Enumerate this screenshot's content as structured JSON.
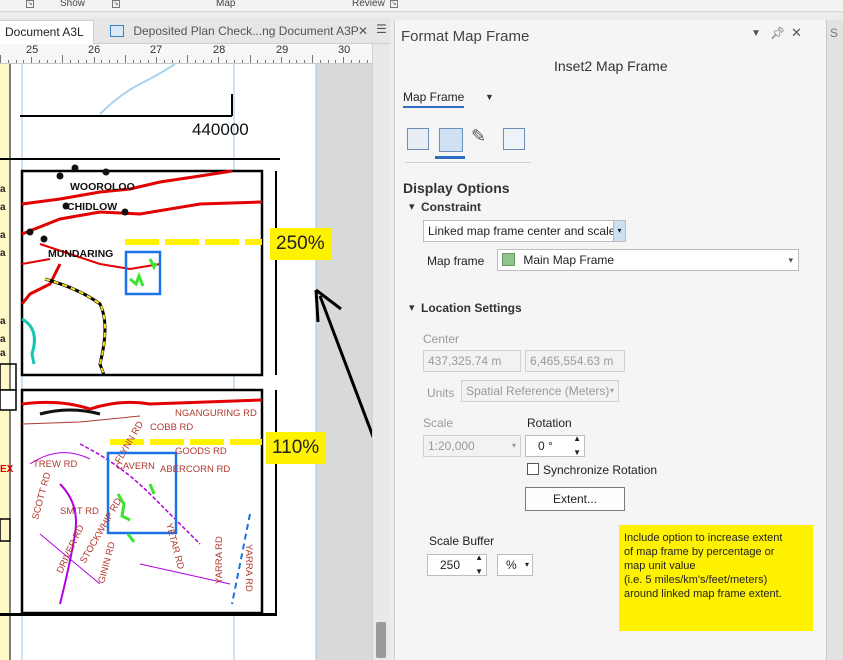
{
  "ribbon": {
    "groups": [
      "Show",
      "Map",
      "Review"
    ]
  },
  "tabs": [
    {
      "label": "Document A3L",
      "active": true
    },
    {
      "label": "Deposited Plan Check...ng Document A3P",
      "active": false
    }
  ],
  "ruler": {
    "marks": [
      "25",
      "26",
      "27",
      "28",
      "29",
      "30"
    ]
  },
  "map": {
    "coord_label": "440000",
    "top_frame_labels": [
      "WOOROLOO",
      "CHIDLOW",
      "MUNDARING"
    ],
    "bottom_frame_labels": [
      "FLYNN RD",
      "NGANGURING RD",
      "COBB RD",
      "GOODS RD",
      "CAVERN",
      "ABERCORN RD",
      "TREW RD",
      "SCOTT RD",
      "SMIT RD",
      "DRIVER RD",
      "STOCKWHIP RD",
      "GININ RD",
      "YETAR RD",
      "YARRA RD",
      "YARRA RD"
    ],
    "left_strip_letters": [
      "a",
      "a",
      "a",
      "a",
      "a",
      "a",
      "a",
      "EX"
    ],
    "badge_top": "250%",
    "badge_bottom": "110%",
    "accent_colors": {
      "red": "#e30000",
      "blue": "#1a73e8",
      "yellow": "#fff200",
      "green": "#39e62a"
    }
  },
  "panel": {
    "title": "Format Map Frame",
    "subtitle": "Inset2 Map Frame",
    "dropdown_label": "Map Frame",
    "display_options": "Display Options",
    "constraint_header": "Constraint",
    "constraint_value": "Linked map frame center and scale",
    "map_frame_label": "Map frame",
    "map_frame_value": "Main Map Frame",
    "location_header": "Location Settings",
    "center_label": "Center",
    "center_x": "437,325.74 m",
    "center_y": "6,465,554.63 m",
    "units_label": "Units",
    "units_value": "Spatial Reference (Meters)",
    "scale_label": "Scale",
    "scale_value": "1:20,000",
    "rotation_label": "Rotation",
    "rotation_value": "0 °",
    "sync_rotation_label": "Synchronize Rotation",
    "extent_button": "Extent...",
    "scale_buffer_label": "Scale Buffer",
    "scale_buffer_value": "250",
    "scale_buffer_unit": "%",
    "note_lines": [
      "Include option to increase extent",
      "of map frame by percentage or",
      "map unit value",
      "(i.e. 5 miles/km's/feet/meters)",
      "around linked map frame extent."
    ]
  }
}
